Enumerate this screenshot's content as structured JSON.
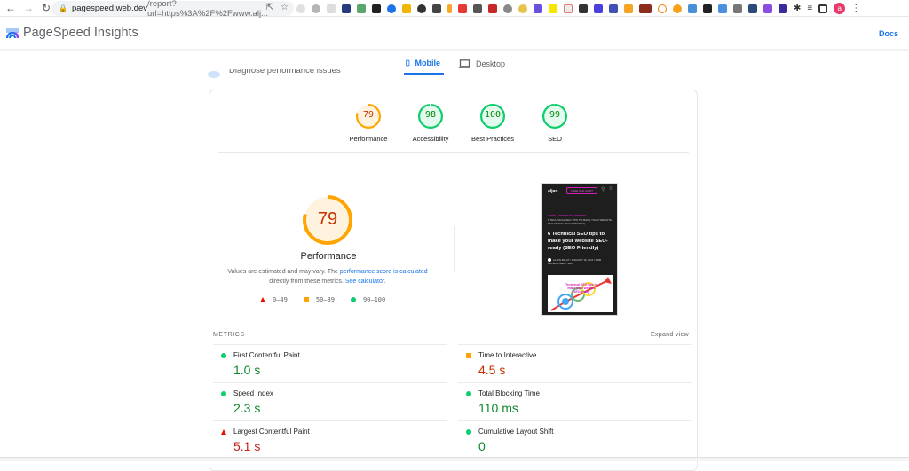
{
  "browser": {
    "url_host": "pagespeed.web.dev",
    "url_path": "/report?url=https%3A%2F%2Fwww.alj...",
    "back_icon": "arrow-left-icon",
    "forward_icon": "arrow-right-icon",
    "reload_icon": "reload-icon",
    "profile_initial": "a"
  },
  "header": {
    "title": "PageSpeed Insights",
    "docs_label": "Docs"
  },
  "tabs": [
    {
      "label": "Mobile",
      "active": true
    },
    {
      "label": "Desktop",
      "active": false
    }
  ],
  "section_partial_label": "Diagnose performance issues",
  "scores": [
    {
      "label": "Performance",
      "value": "79",
      "score": 79,
      "rating": "average"
    },
    {
      "label": "Accessibility",
      "value": "98",
      "score": 98,
      "rating": "pass"
    },
    {
      "label": "Best Practices",
      "value": "100",
      "score": 100,
      "rating": "pass"
    },
    {
      "label": "SEO",
      "value": "99",
      "score": 99,
      "rating": "pass"
    }
  ],
  "performance": {
    "score": "79",
    "score_fraction": 0.79,
    "label": "Performance",
    "desc_prefix": "Values are estimated and may vary. The ",
    "desc_link1": "performance score is calculated",
    "desc_mid": " directly from these metrics. ",
    "desc_link2": "See calculator.",
    "legend": [
      {
        "shape": "triangle",
        "range": "0–49"
      },
      {
        "shape": "square",
        "range": "50–89"
      },
      {
        "shape": "circle",
        "range": "90–100"
      }
    ]
  },
  "screenshot": {
    "brand": "aljan",
    "cta": "FREE SEO AUDIT",
    "breadcrumb": "HOME » WEB DEVELOPMENT »",
    "breadcrumb_sub": "6 TECHNICAL SEO TIPS TO MAKE YOUR WEBSITE SEO-READY (SEO FRIENDLY)",
    "heading": "6 Technical SEO tips to make your website SEO-ready (SEO Friendly)",
    "author_line": "ALJON BALAT / JANUARY 18, 2021 / WEB DEVELOPMENT, SEO",
    "hero_text": "Technical SEO tips to make your website SEO-ready"
  },
  "metrics": {
    "title": "METRICS",
    "expand_label": "Expand view",
    "items": [
      {
        "label": "First Contentful Paint",
        "value": "1.0 s",
        "rating": "pass"
      },
      {
        "label": "Time to Interactive",
        "value": "4.5 s",
        "rating": "average"
      },
      {
        "label": "Speed Index",
        "value": "2.3 s",
        "rating": "pass"
      },
      {
        "label": "Total Blocking Time",
        "value": "110 ms",
        "rating": "pass"
      },
      {
        "label": "Largest Contentful Paint",
        "value": "5.1 s",
        "rating": "fail"
      },
      {
        "label": "Cumulative Layout Shift",
        "value": "0",
        "rating": "pass"
      }
    ]
  },
  "colors": {
    "pass": "#0cce6b",
    "average": "#ffa400",
    "fail": "#ff4e42",
    "accent": "#1a73e8"
  }
}
